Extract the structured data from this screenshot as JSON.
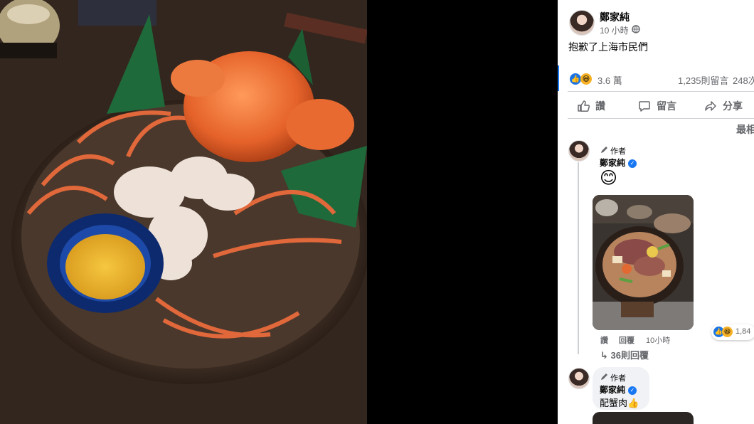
{
  "post": {
    "author": "鄭家純",
    "time": "10 小時 ·",
    "privacy_icon": "globe-icon",
    "text": "抱歉了上海市民們"
  },
  "reactions": {
    "count": "3.6 萬",
    "comments": "1,235則留言",
    "shares": "248次"
  },
  "actions": {
    "like": "讚",
    "comment": "留言",
    "share": "分享"
  },
  "sort_label": "最相",
  "comments": [
    {
      "author_badge": "作者",
      "author": "鄭家純",
      "content": "😊",
      "like_label": "讚",
      "reply_label": "回覆",
      "time": "10小時",
      "reaction_count": "1,84",
      "replies_label": "36則回覆"
    },
    {
      "author_badge": "作者",
      "author": "鄭家純",
      "content": "配蟹肉👍"
    }
  ],
  "colors": {
    "accent": "#1877f2",
    "muted": "#65676b",
    "divider": "#ced0d4",
    "bubble": "#f0f2f5"
  }
}
